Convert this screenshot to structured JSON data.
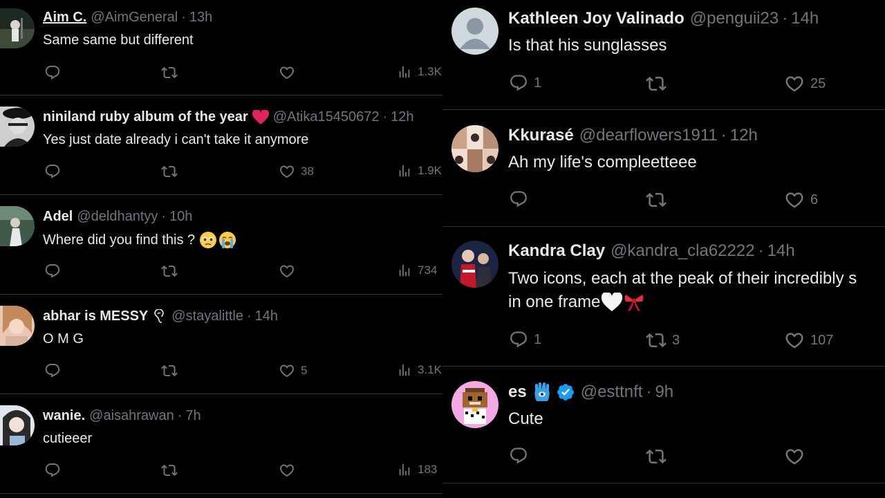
{
  "left_feed": [
    {
      "name": "Aim C.",
      "handle": "@AimGeneral",
      "time": "13h",
      "text": "Same same but different",
      "likes": "",
      "views": "1.3K"
    },
    {
      "name": "niniland ruby album of the year",
      "handle": "@Atika15450672",
      "time": "12h",
      "text": "Yes just date already i can't take it anymore",
      "likes": "38",
      "views": "1.9K"
    },
    {
      "name": "Adel",
      "handle": "@deldhantyy",
      "time": "10h",
      "text": "Where did you find this ?",
      "likes": "",
      "views": "734"
    },
    {
      "name": "abhar is MESSY",
      "handle": "@stayalittle",
      "time": "14h",
      "text": "O M G",
      "likes": "5",
      "views": "3.1K"
    },
    {
      "name": "wanie.",
      "handle": "@aisahrawan",
      "time": "7h",
      "text": "cutieeer",
      "likes": "",
      "views": "183"
    }
  ],
  "right_feed": [
    {
      "name": "Kathleen Joy Valinado",
      "handle": "@penguii23",
      "time": "14h",
      "text": "Is that his sunglasses",
      "replies": "1",
      "retweets": "",
      "likes": "25"
    },
    {
      "name": "Kkurasé",
      "handle": "@dearflowers1911",
      "time": "12h",
      "text": "Ah my life's compleetteee",
      "replies": "",
      "retweets": "",
      "likes": "6"
    },
    {
      "name": "Kandra Clay",
      "handle": "@kandra_cla62222",
      "time": "14h",
      "text": "Two icons, each at the peak of their incredibly s",
      "text_line2": "in one frame",
      "replies": "1",
      "retweets": "3",
      "likes": "107"
    },
    {
      "name": "es",
      "handle": "@esttnft",
      "time": "9h",
      "text": "Cute",
      "replies": "",
      "retweets": "",
      "likes": ""
    }
  ],
  "colors": {
    "background": "#000000",
    "text_primary": "#e7e9ea",
    "text_secondary": "#71767b",
    "divider": "#2f3336",
    "verified_blue": "#1d9bf0",
    "heart_red": "#e0245e"
  },
  "icons": {
    "reply": "reply-icon",
    "retweet": "retweet-icon",
    "like": "heart-icon",
    "views": "views-icon",
    "verified": "verified-badge-icon"
  }
}
